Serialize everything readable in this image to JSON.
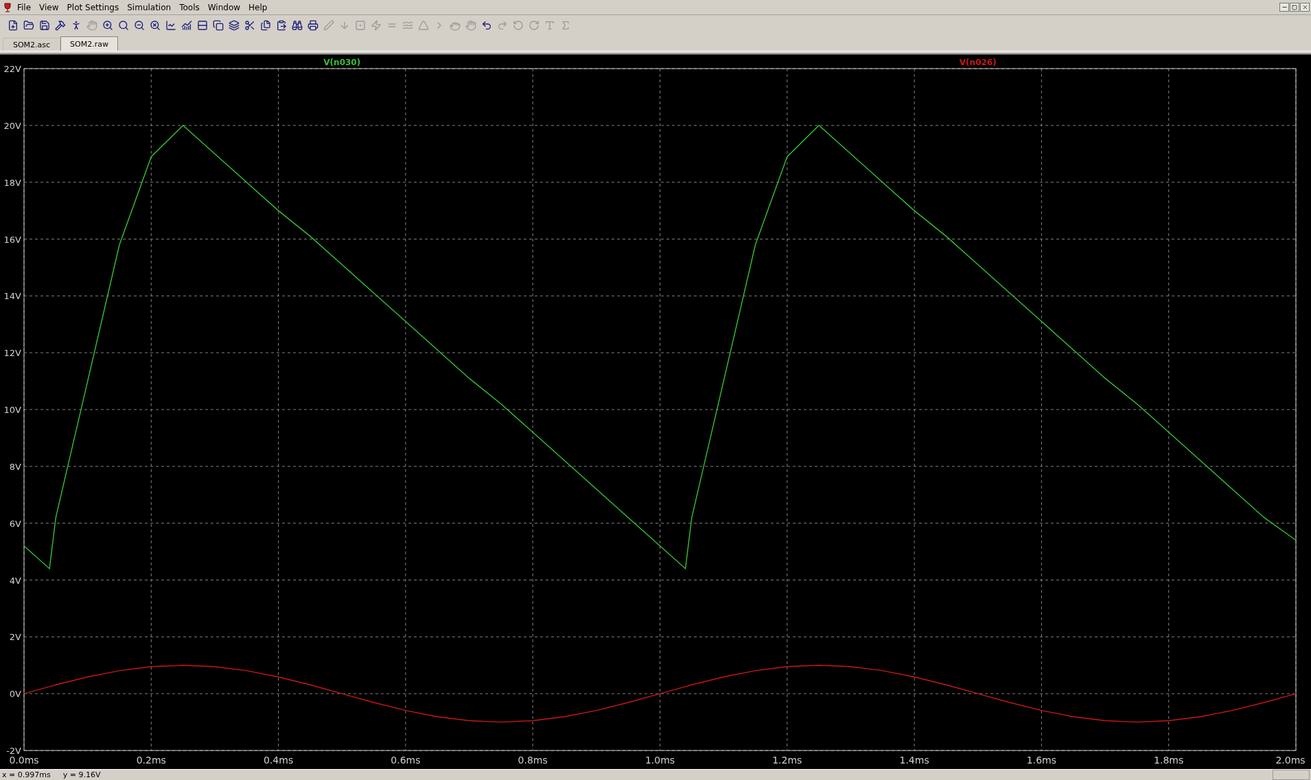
{
  "menu": [
    "File",
    "View",
    "Plot Settings",
    "Simulation",
    "Tools",
    "Window",
    "Help"
  ],
  "toolbar": [
    {
      "disabled": false
    },
    {
      "disabled": false
    },
    {
      "disabled": false
    },
    {
      "disabled": false
    },
    {
      "disabled": false
    },
    {
      "disabled": true
    },
    {
      "disabled": false
    },
    {
      "disabled": false
    },
    {
      "disabled": false
    },
    {
      "disabled": false
    },
    {
      "disabled": false
    },
    {
      "disabled": false
    },
    {
      "disabled": false
    },
    {
      "disabled": false
    },
    {
      "disabled": false
    },
    {
      "disabled": false
    },
    {
      "disabled": false
    },
    {
      "disabled": false
    },
    {
      "disabled": false
    },
    {
      "disabled": false
    },
    {
      "disabled": true
    },
    {
      "disabled": true
    },
    {
      "disabled": true
    },
    {
      "disabled": true
    },
    {
      "disabled": true
    },
    {
      "disabled": true
    },
    {
      "disabled": true
    },
    {
      "disabled": true
    },
    {
      "disabled": true
    },
    {
      "disabled": true
    },
    {
      "disabled": false
    },
    {
      "disabled": true
    },
    {
      "disabled": true
    },
    {
      "disabled": true
    },
    {
      "disabled": true
    },
    {
      "disabled": true
    }
  ],
  "tabs": [
    {
      "label": "SOM2.asc",
      "selected": false
    },
    {
      "label": "SOM2.raw",
      "selected": true
    }
  ],
  "plot": {
    "chart_data": {
      "type": "line",
      "grid": true,
      "x": [
        0,
        0.04,
        0.05,
        0.1,
        0.15,
        0.2,
        0.25,
        0.3,
        0.35,
        0.4,
        0.45,
        0.5,
        0.55,
        0.6,
        0.65,
        0.7,
        0.75,
        0.8,
        0.85,
        0.9,
        0.95,
        1.0,
        1.04,
        1.05,
        1.1,
        1.15,
        1.2,
        1.25,
        1.3,
        1.35,
        1.4,
        1.45,
        1.5,
        1.55,
        1.6,
        1.65,
        1.7,
        1.75,
        1.8,
        1.85,
        1.9,
        1.95,
        2.0
      ],
      "series": [
        {
          "name": "V(n030)",
          "color": "#33c133",
          "values": [
            5.2,
            4.4,
            6.2,
            11.0,
            15.8,
            18.9,
            20,
            19.0,
            18.0,
            17.0,
            16.1,
            15.1,
            14.1,
            13.1,
            12.1,
            11.1,
            10.2,
            9.2,
            8.2,
            7.2,
            6.2,
            5.2,
            4.4,
            6.2,
            11.0,
            15.8,
            18.9,
            20,
            19.0,
            18.0,
            17.0,
            16.1,
            15.1,
            14.1,
            13.1,
            12.1,
            11.1,
            10.2,
            9.2,
            8.2,
            7.2,
            6.2,
            5.4
          ]
        },
        {
          "name": "V(n026)",
          "color": "#c81818",
          "values": [
            0,
            0.25,
            0.31,
            0.59,
            0.81,
            0.95,
            1,
            0.95,
            0.81,
            0.59,
            0.31,
            0,
            -0.31,
            -0.59,
            -0.81,
            -0.95,
            -1,
            -0.95,
            -0.81,
            -0.59,
            -0.31,
            0,
            0.25,
            0.31,
            0.59,
            0.81,
            0.95,
            1,
            0.95,
            0.81,
            0.59,
            0.31,
            0,
            -0.31,
            -0.59,
            -0.81,
            -0.95,
            -1,
            -0.95,
            -0.81,
            -0.59,
            -0.31,
            0
          ]
        }
      ],
      "xlim": [
        0,
        2
      ],
      "ylim": [
        -2,
        22
      ],
      "xticks": [
        {
          "value": 0,
          "label": "0.0ms"
        },
        {
          "value": 0.2,
          "label": "0.2ms"
        },
        {
          "value": 0.4,
          "label": "0.4ms"
        },
        {
          "value": 0.6,
          "label": "0.6ms"
        },
        {
          "value": 0.8,
          "label": "0.8ms"
        },
        {
          "value": 1.0,
          "label": "1.0ms"
        },
        {
          "value": 1.2,
          "label": "1.2ms"
        },
        {
          "value": 1.4,
          "label": "1.4ms"
        },
        {
          "value": 1.6,
          "label": "1.6ms"
        },
        {
          "value": 1.8,
          "label": "1.8ms"
        },
        {
          "value": 2.0,
          "label": "2.0ms"
        }
      ],
      "yticks": [
        {
          "value": -2,
          "label": "-2V"
        },
        {
          "value": 0,
          "label": "0V"
        },
        {
          "value": 2,
          "label": "2V"
        },
        {
          "value": 4,
          "label": "4V"
        },
        {
          "value": 6,
          "label": "6V"
        },
        {
          "value": 8,
          "label": "8V"
        },
        {
          "value": 10,
          "label": "10V"
        },
        {
          "value": 12,
          "label": "12V"
        },
        {
          "value": 14,
          "label": "14V"
        },
        {
          "value": 16,
          "label": "16V"
        },
        {
          "value": 18,
          "label": "18V"
        },
        {
          "value": 20,
          "label": "20V"
        },
        {
          "value": 22,
          "label": "22V"
        }
      ]
    }
  },
  "status_bar": {
    "x_reading": "x = 0.997ms",
    "y_reading": "y = 9.16V"
  }
}
